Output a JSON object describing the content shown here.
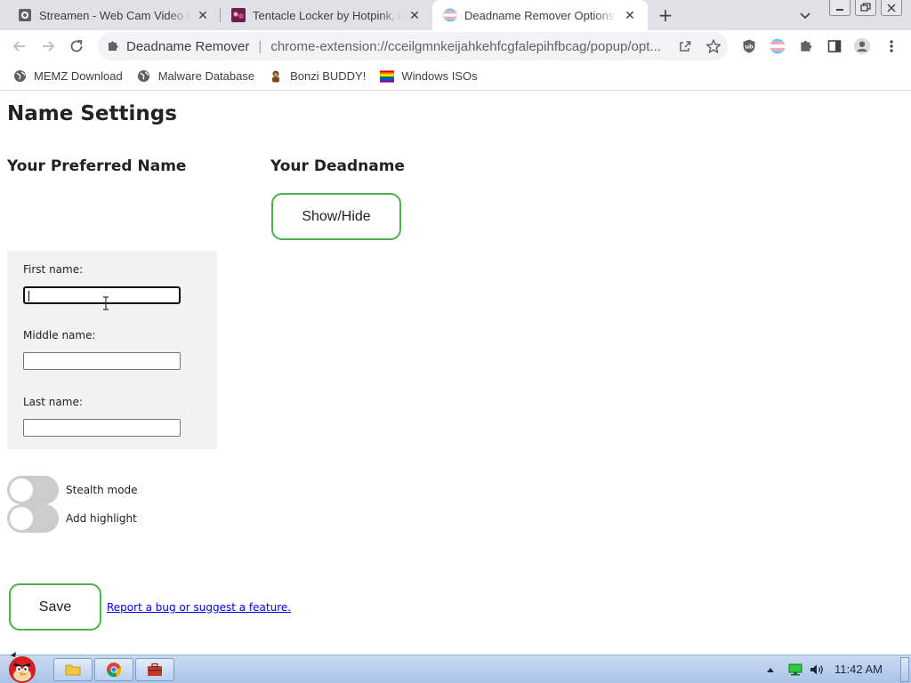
{
  "tabs": [
    {
      "title": "Streamen - Web Cam Video Chat",
      "icon": "webcam-tab-icon"
    },
    {
      "title": "Tentacle Locker by Hotpink, A",
      "icon": "anime-tab-icon"
    },
    {
      "title": "Deadname Remover Options",
      "icon": "trans-flag-tab-icon",
      "active": true
    }
  ],
  "omnibox": {
    "site": "Deadname Remover",
    "url": "chrome-extension://cceilgmnkeijahkehfcgfalepihfbcag/popup/opt..."
  },
  "bookmarks": [
    {
      "label": "MEMZ Download",
      "icon": "globe-icon"
    },
    {
      "label": "Malware Database",
      "icon": "globe-icon"
    },
    {
      "label": "Bonzi BUDDY!",
      "icon": "bonzi-icon"
    },
    {
      "label": "Windows ISOs",
      "icon": "rainbow-flag-icon"
    }
  ],
  "page": {
    "title": "Name Settings",
    "preferred_heading": "Your Preferred Name",
    "deadname_heading": "Your Deadname",
    "show_hide_label": "Show/Hide",
    "fields": [
      {
        "label": "First name:",
        "value": ""
      },
      {
        "label": "Middle name:",
        "value": ""
      },
      {
        "label": "Last name:",
        "value": ""
      }
    ],
    "toggles": [
      {
        "label": "Stealth mode",
        "on": false
      },
      {
        "label": "Add highlight",
        "on": false
      }
    ],
    "save_label": "Save",
    "report_link": "Report a bug or suggest a feature."
  },
  "taskbar": {
    "clock": "11:42 AM"
  },
  "colors": {
    "accent_green": "#4caf50",
    "link_blue": "#0000ee",
    "name_panel_bg": "#f2f2f2",
    "switch_off": "#cccccc"
  }
}
